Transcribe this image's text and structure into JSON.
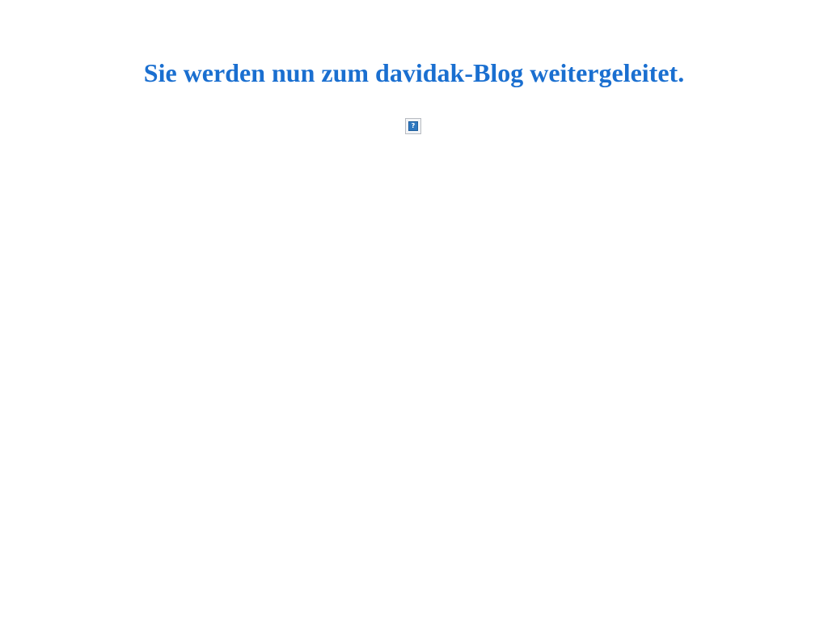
{
  "page": {
    "heading": "Sie werden nun zum davidak-Blog weitergeleitet.",
    "image": {
      "icon": "broken-image-icon",
      "glyph": "?"
    }
  },
  "colors": {
    "heading": "#1a6fd0",
    "background": "#ffffff",
    "icon_fill": "#2f78bf"
  }
}
